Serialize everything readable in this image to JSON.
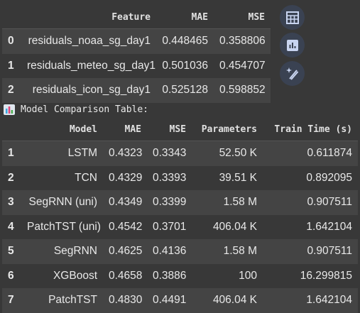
{
  "feature_table": {
    "headers": [
      "",
      "Feature",
      "MAE",
      "MSE"
    ],
    "rows": [
      {
        "index": "0",
        "feature": "residuals_noaa_sg_day1",
        "mae": "0.448465",
        "mse": "0.358806"
      },
      {
        "index": "1",
        "feature": "residuals_meteo_sg_day1",
        "mae": "0.501036",
        "mse": "0.454707"
      },
      {
        "index": "2",
        "feature": "residuals_icon_sg_day1",
        "mae": "0.525128",
        "mse": "0.598852"
      }
    ]
  },
  "side_buttons": {
    "icons": [
      "table-icon",
      "chart-icon",
      "magic-edit-icon"
    ]
  },
  "caption": {
    "text": "Model Comparison Table:",
    "icon": "bar-chart-emoji-icon"
  },
  "model_table": {
    "headers": [
      "",
      "Model",
      "MAE",
      "MSE",
      "Parameters",
      "Train Time (s)"
    ],
    "rows": [
      {
        "index": "1",
        "model": "LSTM",
        "mae": "0.4323",
        "mse": "0.3343",
        "params": "52.50 K",
        "time": "0.611874"
      },
      {
        "index": "2",
        "model": "TCN",
        "mae": "0.4329",
        "mse": "0.3393",
        "params": "39.51 K",
        "time": "0.892095"
      },
      {
        "index": "3",
        "model": "SegRNN (uni)",
        "mae": "0.4349",
        "mse": "0.3399",
        "params": "1.58 M",
        "time": "0.907511"
      },
      {
        "index": "4",
        "model": "PatchTST (uni)",
        "mae": "0.4542",
        "mse": "0.3701",
        "params": "406.04 K",
        "time": "1.642104"
      },
      {
        "index": "5",
        "model": "SegRNN",
        "mae": "0.4625",
        "mse": "0.4136",
        "params": "1.58 M",
        "time": "0.907511"
      },
      {
        "index": "6",
        "model": "XGBoost",
        "mae": "0.4658",
        "mse": "0.3886",
        "params": "100",
        "time": "16.299815"
      },
      {
        "index": "7",
        "model": "PatchTST",
        "mae": "0.4830",
        "mse": "0.4491",
        "params": "406.04 K",
        "time": "1.642104"
      }
    ]
  }
}
